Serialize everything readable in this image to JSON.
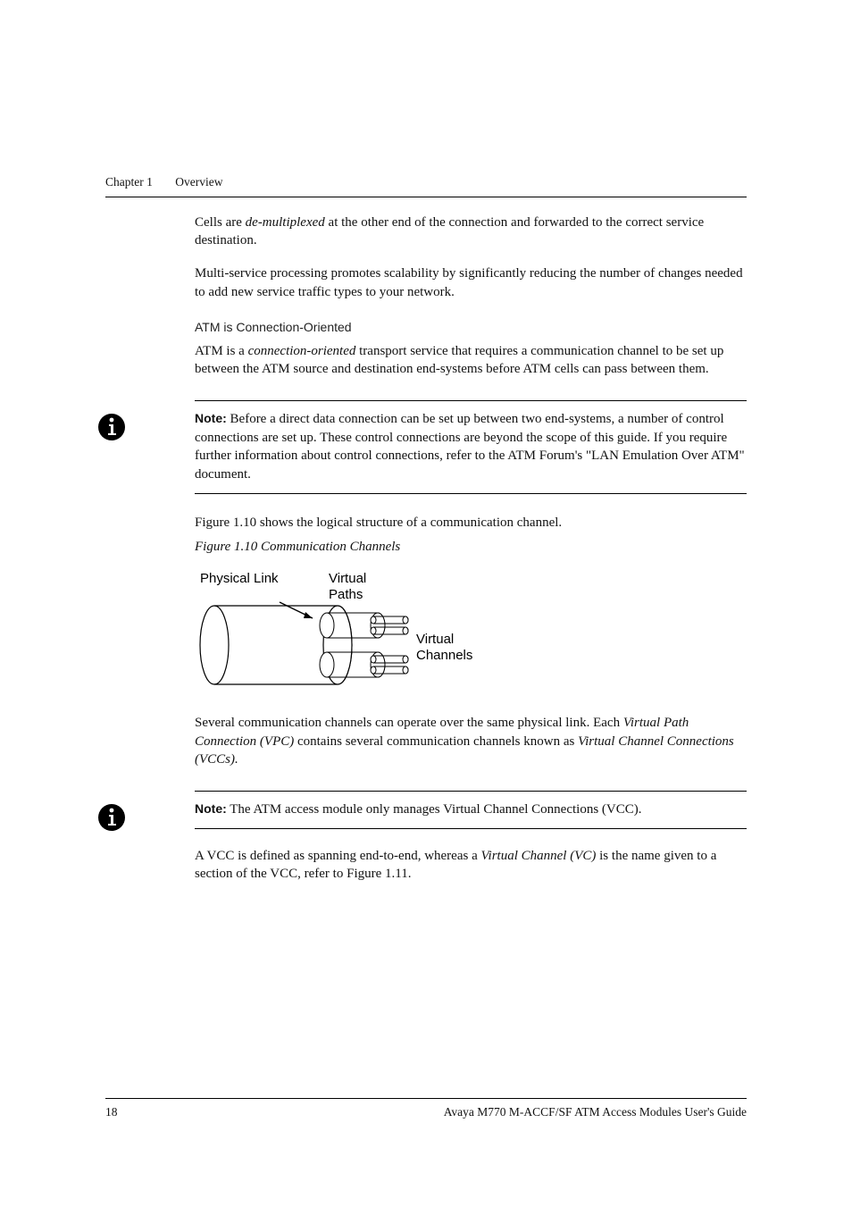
{
  "runningHead": {
    "chapter": "Chapter 1",
    "title": "Overview"
  },
  "body": {
    "p1a": "Cells are ",
    "p1em": "de-multiplexed",
    "p1b": " at the other end of the connection and forwarded to the correct service destination.",
    "p2": "Multi-service processing promotes scalability by significantly reducing the number of changes needed to add new service traffic types to your network.",
    "sub1": "ATM is Connection-Oriented",
    "p3a": "ATM is a ",
    "p3em": "connection-oriented",
    "p3b": " transport service that requires a communication channel to be set up between the ATM source and destination end-systems before ATM cells can pass between them.",
    "p4": "Figure 1.10 shows the logical structure of a communication channel.",
    "figcap": "Figure 1.10    Communication Channels",
    "figlabels": {
      "phys": "Physical Link",
      "vp": "Virtual",
      "vp2": "Paths",
      "vc1": "Virtual",
      "vc2": "Channels"
    },
    "p5a": "Several communication channels can operate over the same physical link. Each ",
    "p5em1": "Virtual Path Connection (VPC)",
    "p5b": " contains several communication channels known as ",
    "p5em2": "Virtual Channel Connections (VCCs).",
    "p6a": "A VCC is defined as spanning end-to-end, whereas a ",
    "p6em": "Virtual Channel (VC)",
    "p6b": " is the name given to a section of the VCC, refer to Figure 1.11."
  },
  "notes": {
    "label": "Note:",
    "n1": "  Before a direct data connection can be set up between two end-systems, a number of control connections are set up. These control connections are beyond the scope of this guide. If you require further information about control connections, refer to the ATM Forum's \"LAN Emulation Over ATM\" document.",
    "n2": "  The ATM access module only manages Virtual Channel Connections (VCC)."
  },
  "footer": {
    "page": "18",
    "title": "Avaya M770 M-ACCF/SF ATM Access Modules User's Guide"
  }
}
